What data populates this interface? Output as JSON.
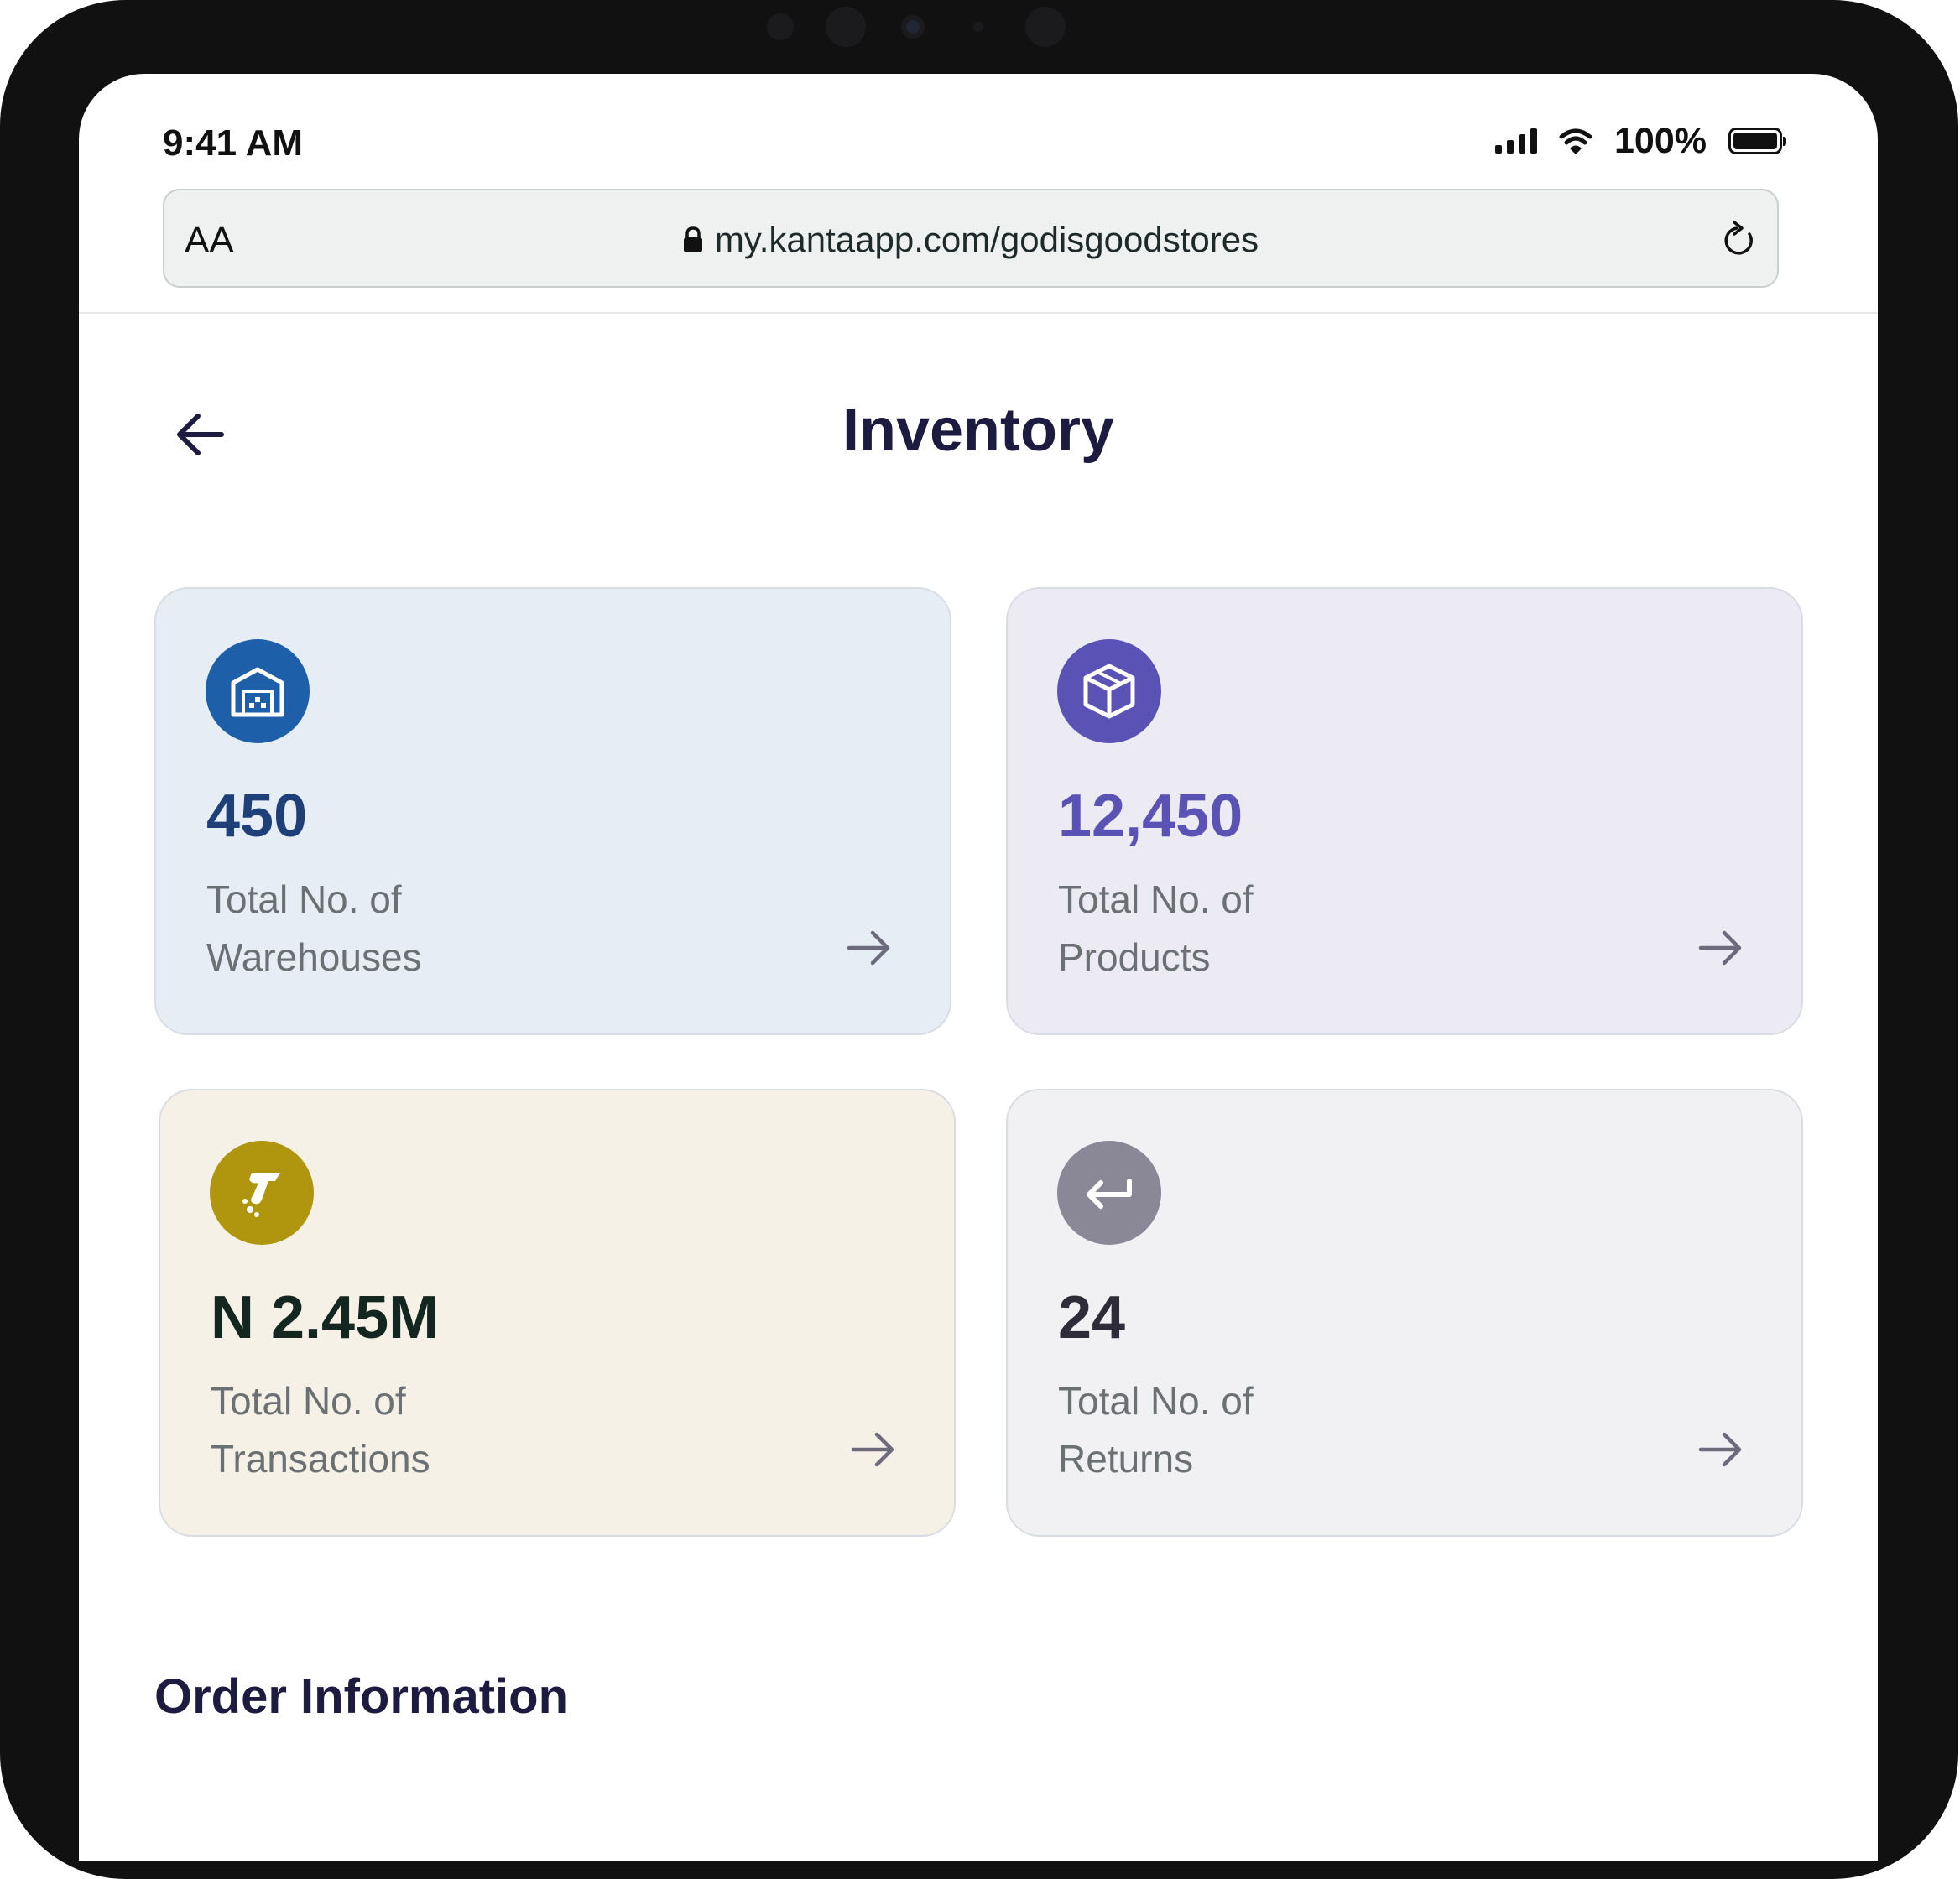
{
  "status_bar": {
    "time": "9:41 AM",
    "battery": "100%"
  },
  "browser": {
    "text_size_label": "AA",
    "url": "my.kantaapp.com/godisgoodstores"
  },
  "header": {
    "title": "Inventory"
  },
  "cards": [
    {
      "value": "450",
      "label_line1": "Total No. of",
      "label_line2": "Warehouses",
      "icon": "warehouse-icon",
      "icon_color": "#1d5fa8",
      "value_color": "#1e3f78",
      "bg": "#e6edf5"
    },
    {
      "value": "12,450",
      "label_line1": "Total No. of",
      "label_line2": "Products",
      "icon": "box-icon",
      "icon_color": "#5a52b5",
      "value_color": "#5a52b5",
      "bg": "#ecebf4"
    },
    {
      "value": "N 2.45M",
      "label_line1": "Total No. of",
      "label_line2": "Transactions",
      "icon": "payment-icon",
      "icon_color": "#b0950f",
      "value_color": "#13261f",
      "bg": "#f5f1e6"
    },
    {
      "value": "24",
      "label_line1": "Total No. of",
      "label_line2": "Returns",
      "icon": "return-icon",
      "icon_color": "#8a8796",
      "value_color": "#2e2c38",
      "bg": "#f1f1f4"
    }
  ],
  "sections": {
    "order_information": "Order Information"
  }
}
